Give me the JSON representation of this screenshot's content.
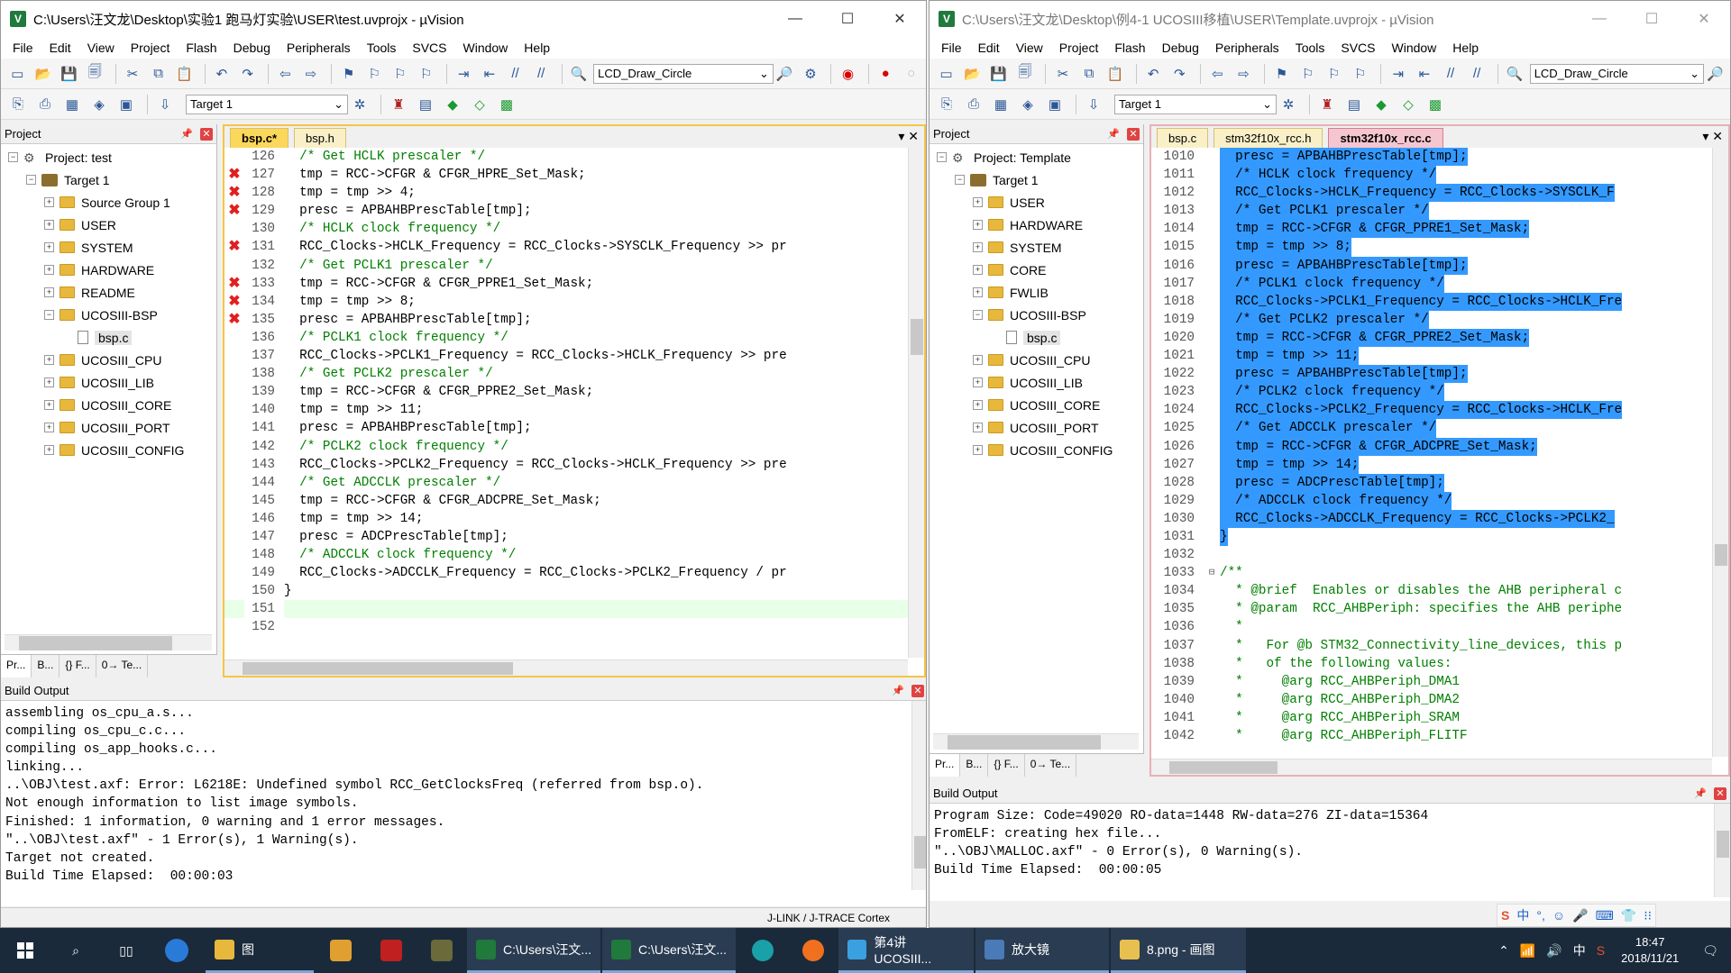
{
  "left": {
    "title": "C:\\Users\\汪文龙\\Desktop\\实验1 跑马灯实验\\USER\\test.uvprojx - µVision",
    "menu": [
      "File",
      "Edit",
      "View",
      "Project",
      "Flash",
      "Debug",
      "Peripherals",
      "Tools",
      "SVCS",
      "Window",
      "Help"
    ],
    "func_combo": "LCD_Draw_Circle",
    "target_combo": "Target 1",
    "project_title": "Project",
    "tree": [
      {
        "label": "Project: test",
        "depth": 0,
        "exp": "−",
        "icon": "project"
      },
      {
        "label": "Target 1",
        "depth": 1,
        "exp": "−",
        "icon": "target"
      },
      {
        "label": "Source Group 1",
        "depth": 2,
        "exp": "+",
        "icon": "folder"
      },
      {
        "label": "USER",
        "depth": 2,
        "exp": "+",
        "icon": "folder"
      },
      {
        "label": "SYSTEM",
        "depth": 2,
        "exp": "+",
        "icon": "folder"
      },
      {
        "label": "HARDWARE",
        "depth": 2,
        "exp": "+",
        "icon": "folder"
      },
      {
        "label": "README",
        "depth": 2,
        "exp": "+",
        "icon": "folder"
      },
      {
        "label": "UCOSIII-BSP",
        "depth": 2,
        "exp": "−",
        "icon": "folder"
      },
      {
        "label": "bsp.c",
        "depth": 3,
        "exp": "",
        "icon": "file"
      },
      {
        "label": "UCOSIII_CPU",
        "depth": 2,
        "exp": "+",
        "icon": "folder"
      },
      {
        "label": "UCOSIII_LIB",
        "depth": 2,
        "exp": "+",
        "icon": "folder"
      },
      {
        "label": "UCOSIII_CORE",
        "depth": 2,
        "exp": "+",
        "icon": "folder"
      },
      {
        "label": "UCOSIII_PORT",
        "depth": 2,
        "exp": "+",
        "icon": "folder"
      },
      {
        "label": "UCOSIII_CONFIG",
        "depth": 2,
        "exp": "+",
        "icon": "folder"
      }
    ],
    "bottom_tabs": [
      "Pr...",
      "B...",
      "{} F...",
      "0→ Te..."
    ],
    "file_tabs": [
      {
        "label": "bsp.c*",
        "active": true
      },
      {
        "label": "bsp.h",
        "active": false
      }
    ],
    "code": [
      {
        "n": "126",
        "err": false,
        "t": "  /* Get HCLK prescaler */",
        "c": true
      },
      {
        "n": "127",
        "err": true,
        "t": "  tmp = RCC->CFGR & CFGR_HPRE_Set_Mask;",
        "c": false
      },
      {
        "n": "128",
        "err": true,
        "t": "  tmp = tmp >> 4;",
        "c": false
      },
      {
        "n": "129",
        "err": true,
        "t": "  presc = APBAHBPrescTable[tmp];",
        "c": false
      },
      {
        "n": "130",
        "err": false,
        "t": "  /* HCLK clock frequency */",
        "c": true
      },
      {
        "n": "131",
        "err": true,
        "t": "  RCC_Clocks->HCLK_Frequency = RCC_Clocks->SYSCLK_Frequency >> pr",
        "c": false
      },
      {
        "n": "132",
        "err": false,
        "t": "  /* Get PCLK1 prescaler */",
        "c": true
      },
      {
        "n": "133",
        "err": true,
        "t": "  tmp = RCC->CFGR & CFGR_PPRE1_Set_Mask;",
        "c": false
      },
      {
        "n": "134",
        "err": true,
        "t": "  tmp = tmp >> 8;",
        "c": false
      },
      {
        "n": "135",
        "err": true,
        "t": "  presc = APBAHBPrescTable[tmp];",
        "c": false
      },
      {
        "n": "136",
        "err": false,
        "t": "  /* PCLK1 clock frequency */",
        "c": true
      },
      {
        "n": "137",
        "err": false,
        "t": "  RCC_Clocks->PCLK1_Frequency = RCC_Clocks->HCLK_Frequency >> pre",
        "c": false
      },
      {
        "n": "138",
        "err": false,
        "t": "  /* Get PCLK2 prescaler */",
        "c": true
      },
      {
        "n": "139",
        "err": false,
        "t": "  tmp = RCC->CFGR & CFGR_PPRE2_Set_Mask;",
        "c": false
      },
      {
        "n": "140",
        "err": false,
        "t": "  tmp = tmp >> 11;",
        "c": false
      },
      {
        "n": "141",
        "err": false,
        "t": "  presc = APBAHBPrescTable[tmp];",
        "c": false
      },
      {
        "n": "142",
        "err": false,
        "t": "  /* PCLK2 clock frequency */",
        "c": true
      },
      {
        "n": "143",
        "err": false,
        "t": "  RCC_Clocks->PCLK2_Frequency = RCC_Clocks->HCLK_Frequency >> pre",
        "c": false
      },
      {
        "n": "144",
        "err": false,
        "t": "  /* Get ADCCLK prescaler */",
        "c": true
      },
      {
        "n": "145",
        "err": false,
        "t": "  tmp = RCC->CFGR & CFGR_ADCPRE_Set_Mask;",
        "c": false
      },
      {
        "n": "146",
        "err": false,
        "t": "  tmp = tmp >> 14;",
        "c": false
      },
      {
        "n": "147",
        "err": false,
        "t": "  presc = ADCPrescTable[tmp];",
        "c": false
      },
      {
        "n": "148",
        "err": false,
        "t": "  /* ADCCLK clock frequency */",
        "c": true
      },
      {
        "n": "149",
        "err": false,
        "t": "  RCC_Clocks->ADCCLK_Frequency = RCC_Clocks->PCLK2_Frequency / pr",
        "c": false
      },
      {
        "n": "150",
        "err": false,
        "t": "}",
        "c": false
      },
      {
        "n": "151",
        "err": false,
        "t": "",
        "c": false,
        "cur": true
      },
      {
        "n": "152",
        "err": false,
        "t": "",
        "c": false
      }
    ],
    "build_title": "Build Output",
    "build": [
      "assembling os_cpu_a.s...",
      "compiling os_cpu_c.c...",
      "compiling os_app_hooks.c...",
      "linking...",
      "..\\OBJ\\test.axf: Error: L6218E: Undefined symbol RCC_GetClocksFreq (referred from bsp.o).",
      "Not enough information to list image symbols.",
      "Finished: 1 information, 0 warning and 1 error messages.",
      "\"..\\OBJ\\test.axf\" - 1 Error(s), 1 Warning(s).",
      "Target not created.",
      "Build Time Elapsed:  00:00:03"
    ],
    "status": "J-LINK / J-TRACE Cortex"
  },
  "right": {
    "title": "C:\\Users\\汪文龙\\Desktop\\例4-1 UCOSIII移植\\USER\\Template.uvprojx - µVision",
    "menu": [
      "File",
      "Edit",
      "View",
      "Project",
      "Flash",
      "Debug",
      "Peripherals",
      "Tools",
      "SVCS",
      "Window",
      "Help"
    ],
    "func_combo": "LCD_Draw_Circle",
    "target_combo": "Target 1",
    "project_title": "Project",
    "tree": [
      {
        "label": "Project: Template",
        "depth": 0,
        "exp": "−",
        "icon": "project"
      },
      {
        "label": "Target 1",
        "depth": 1,
        "exp": "−",
        "icon": "target"
      },
      {
        "label": "USER",
        "depth": 2,
        "exp": "+",
        "icon": "folder"
      },
      {
        "label": "HARDWARE",
        "depth": 2,
        "exp": "+",
        "icon": "folder"
      },
      {
        "label": "SYSTEM",
        "depth": 2,
        "exp": "+",
        "icon": "folder"
      },
      {
        "label": "CORE",
        "depth": 2,
        "exp": "+",
        "icon": "folder"
      },
      {
        "label": "FWLIB",
        "depth": 2,
        "exp": "+",
        "icon": "folder"
      },
      {
        "label": "UCOSIII-BSP",
        "depth": 2,
        "exp": "−",
        "icon": "folder"
      },
      {
        "label": "bsp.c",
        "depth": 3,
        "exp": "",
        "icon": "file"
      },
      {
        "label": "UCOSIII_CPU",
        "depth": 2,
        "exp": "+",
        "icon": "folder"
      },
      {
        "label": "UCOSIII_LIB",
        "depth": 2,
        "exp": "+",
        "icon": "folder"
      },
      {
        "label": "UCOSIII_CORE",
        "depth": 2,
        "exp": "+",
        "icon": "folder"
      },
      {
        "label": "UCOSIII_PORT",
        "depth": 2,
        "exp": "+",
        "icon": "folder"
      },
      {
        "label": "UCOSIII_CONFIG",
        "depth": 2,
        "exp": "+",
        "icon": "folder"
      }
    ],
    "bottom_tabs": [
      "Pr...",
      "B...",
      "{} F...",
      "0→ Te..."
    ],
    "file_tabs": [
      {
        "label": "bsp.c",
        "active": false
      },
      {
        "label": "stm32f10x_rcc.h",
        "active": false
      },
      {
        "label": "stm32f10x_rcc.c",
        "active": true
      }
    ],
    "code": [
      {
        "n": "1010",
        "t": "  presc = APBAHBPrescTable[tmp];",
        "c": false,
        "sel": true
      },
      {
        "n": "1011",
        "t": "  /* HCLK clock frequency */",
        "c": true,
        "sel": true
      },
      {
        "n": "1012",
        "t": "  RCC_Clocks->HCLK_Frequency = RCC_Clocks->SYSCLK_F",
        "c": false,
        "sel": true
      },
      {
        "n": "1013",
        "t": "  /* Get PCLK1 prescaler */",
        "c": true,
        "sel": true
      },
      {
        "n": "1014",
        "t": "  tmp = RCC->CFGR & CFGR_PPRE1_Set_Mask;",
        "c": false,
        "sel": true
      },
      {
        "n": "1015",
        "t": "  tmp = tmp >> 8;",
        "c": false,
        "sel": true
      },
      {
        "n": "1016",
        "t": "  presc = APBAHBPrescTable[tmp];",
        "c": false,
        "sel": true
      },
      {
        "n": "1017",
        "t": "  /* PCLK1 clock frequency */",
        "c": true,
        "sel": true
      },
      {
        "n": "1018",
        "t": "  RCC_Clocks->PCLK1_Frequency = RCC_Clocks->HCLK_Fre",
        "c": false,
        "sel": true
      },
      {
        "n": "1019",
        "t": "  /* Get PCLK2 prescaler */",
        "c": true,
        "sel": true
      },
      {
        "n": "1020",
        "t": "  tmp = RCC->CFGR & CFGR_PPRE2_Set_Mask;",
        "c": false,
        "sel": true
      },
      {
        "n": "1021",
        "t": "  tmp = tmp >> 11;",
        "c": false,
        "sel": true
      },
      {
        "n": "1022",
        "t": "  presc = APBAHBPrescTable[tmp];",
        "c": false,
        "sel": true
      },
      {
        "n": "1023",
        "t": "  /* PCLK2 clock frequency */",
        "c": true,
        "sel": true
      },
      {
        "n": "1024",
        "t": "  RCC_Clocks->PCLK2_Frequency = RCC_Clocks->HCLK_Fre",
        "c": false,
        "sel": true
      },
      {
        "n": "1025",
        "t": "  /* Get ADCCLK prescaler */",
        "c": true,
        "sel": true
      },
      {
        "n": "1026",
        "t": "  tmp = RCC->CFGR & CFGR_ADCPRE_Set_Mask;",
        "c": false,
        "sel": true
      },
      {
        "n": "1027",
        "t": "  tmp = tmp >> 14;",
        "c": false,
        "sel": true
      },
      {
        "n": "1028",
        "t": "  presc = ADCPrescTable[tmp];",
        "c": false,
        "sel": true
      },
      {
        "n": "1029",
        "t": "  /* ADCCLK clock frequency */",
        "c": true,
        "sel": true
      },
      {
        "n": "1030",
        "t": "  RCC_Clocks->ADCCLK_Frequency = RCC_Clocks->PCLK2_",
        "c": false,
        "sel": true
      },
      {
        "n": "1031",
        "t": "}",
        "c": false,
        "sel": true
      },
      {
        "n": "1032",
        "t": "",
        "c": false,
        "sel": false
      },
      {
        "n": "1033",
        "t": "/**",
        "c": true,
        "sel": false,
        "fold": true
      },
      {
        "n": "1034",
        "t": "  * @brief  Enables or disables the AHB peripheral c",
        "c": true,
        "sel": false
      },
      {
        "n": "1035",
        "t": "  * @param  RCC_AHBPeriph: specifies the AHB periphe",
        "c": true,
        "sel": false
      },
      {
        "n": "1036",
        "t": "  *",
        "c": true,
        "sel": false
      },
      {
        "n": "1037",
        "t": "  *   For @b STM32_Connectivity_line_devices, this p",
        "c": true,
        "sel": false
      },
      {
        "n": "1038",
        "t": "  *   of the following values:",
        "c": true,
        "sel": false
      },
      {
        "n": "1039",
        "t": "  *     @arg RCC_AHBPeriph_DMA1",
        "c": true,
        "sel": false
      },
      {
        "n": "1040",
        "t": "  *     @arg RCC_AHBPeriph_DMA2",
        "c": true,
        "sel": false
      },
      {
        "n": "1041",
        "t": "  *     @arg RCC_AHBPeriph_SRAM",
        "c": true,
        "sel": false
      },
      {
        "n": "1042",
        "t": "  *     @arg RCC_AHBPeriph_FLITF",
        "c": true,
        "sel": false
      }
    ],
    "build_title": "Build Output",
    "build": [
      "Program Size: Code=49020 RO-data=1448 RW-data=276 ZI-data=15364",
      "FromELF: creating hex file...",
      "\"..\\OBJ\\MALLOC.axf\" - 0 Error(s), 0 Warning(s).",
      "Build Time Elapsed:  00:00:05"
    ]
  },
  "taskbar": {
    "apps": [
      {
        "label": "图",
        "color": "#e8b83d"
      },
      {
        "label": "C:\\Users\\汪文...",
        "color": "#1f7a3b"
      },
      {
        "label": "C:\\Users\\汪文...",
        "color": "#1f7a3b"
      },
      {
        "label": "第4讲 UCOSIII...",
        "color": "#3aa0e0"
      },
      {
        "label": "放大镜",
        "color": "#4a7ab8"
      },
      {
        "label": "8.png - 画图",
        "color": "#e8c050"
      }
    ],
    "tray_ime": "中",
    "time": "18:47",
    "date": "2018/11/21"
  },
  "ime_bar": [
    "S",
    "中",
    "°,",
    "☺",
    "🎤",
    "⌨",
    "👕",
    "⁝⁝"
  ]
}
